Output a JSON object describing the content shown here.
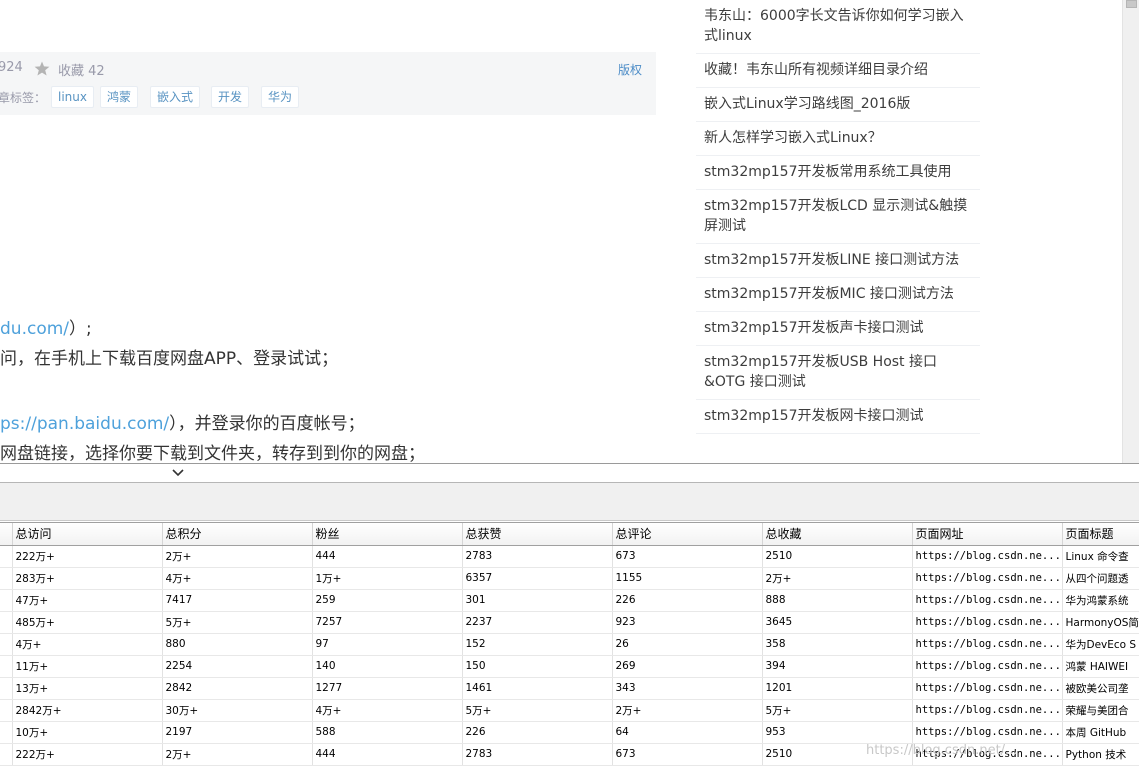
{
  "article": {
    "views_fragment": "924",
    "collect_label": "收藏 42",
    "copyright_label": "版权",
    "tags_label": "章标签：",
    "tags": [
      "linux",
      "鸿蒙",
      "嵌入式",
      "开发",
      "华为"
    ],
    "lines": [
      {
        "link": "du.com/",
        "text": "）;"
      },
      {
        "link": "",
        "text": "问，在手机上下载百度网盘APP、登录试试；"
      },
      {
        "link": "ps://pan.baidu.com/",
        "text": "），并登录你的百度帐号；"
      },
      {
        "link": "",
        "text": "网盘链接，选择你要下载到文件夹，转存到到你的网盘；"
      }
    ]
  },
  "sidebar": {
    "items": [
      "韦东山：6000字长文告诉你如何学习嵌入式linux",
      "收藏！韦东山所有视频详细目录介绍",
      "嵌入式Linux学习路线图_2016版",
      "新人怎样学习嵌入式Linux？",
      "stm32mp157开发板常用系统工具使用",
      "stm32mp157开发板LCD 显示测试&触摸屏测试",
      "stm32mp157开发板LINE 接口测试方法",
      "stm32mp157开发板MIC 接口测试方法",
      "stm32mp157开发板声卡接口测试",
      "stm32mp157开发板USB Host 接口&OTG 接口测试",
      "stm32mp157开发板网卡接口测试"
    ]
  },
  "grid": {
    "columns": [
      "总访问",
      "总积分",
      "粉丝",
      "总获赞",
      "总评论",
      "总收藏",
      "页面网址",
      "页面标题"
    ],
    "rows": [
      [
        "222万+",
        "2万+",
        "444",
        "2783",
        "673",
        "2510",
        "https://blog.csdn.ne...",
        "Linux 命令查"
      ],
      [
        "283万+",
        "4万+",
        "1万+",
        "6357",
        "1155",
        "2万+",
        "https://blog.csdn.ne...",
        "从四个问题透"
      ],
      [
        "47万+",
        "7417",
        "259",
        "301",
        "226",
        "888",
        "https://blog.csdn.ne...",
        "华为鸿蒙系统"
      ],
      [
        "485万+",
        "5万+",
        "7257",
        "2237",
        "923",
        "3645",
        "https://blog.csdn.ne...",
        "HarmonyOS简介"
      ],
      [
        "4万+",
        "880",
        "97",
        "152",
        "26",
        "358",
        "https://blog.csdn.ne...",
        "华为DevEco S"
      ],
      [
        "11万+",
        "2254",
        "140",
        "150",
        "269",
        "394",
        "https://blog.csdn.ne...",
        "鸿蒙 HAIWEI"
      ],
      [
        "13万+",
        "2842",
        "1277",
        "1461",
        "343",
        "1201",
        "https://blog.csdn.ne...",
        "被欧美公司垄"
      ],
      [
        "2842万+",
        "30万+",
        "4万+",
        "5万+",
        "2万+",
        "5万+",
        "https://blog.csdn.ne...",
        "荣耀与美团合"
      ],
      [
        "10万+",
        "2197",
        "588",
        "226",
        "64",
        "953",
        "https://blog.csdn.ne...",
        "本周 GitHub"
      ],
      [
        "222万+",
        "2万+",
        "444",
        "2783",
        "673",
        "2510",
        "https://blog.csdn.ne...",
        "Python 技术"
      ]
    ]
  },
  "watermark": "https://blog.csdn.net/..."
}
